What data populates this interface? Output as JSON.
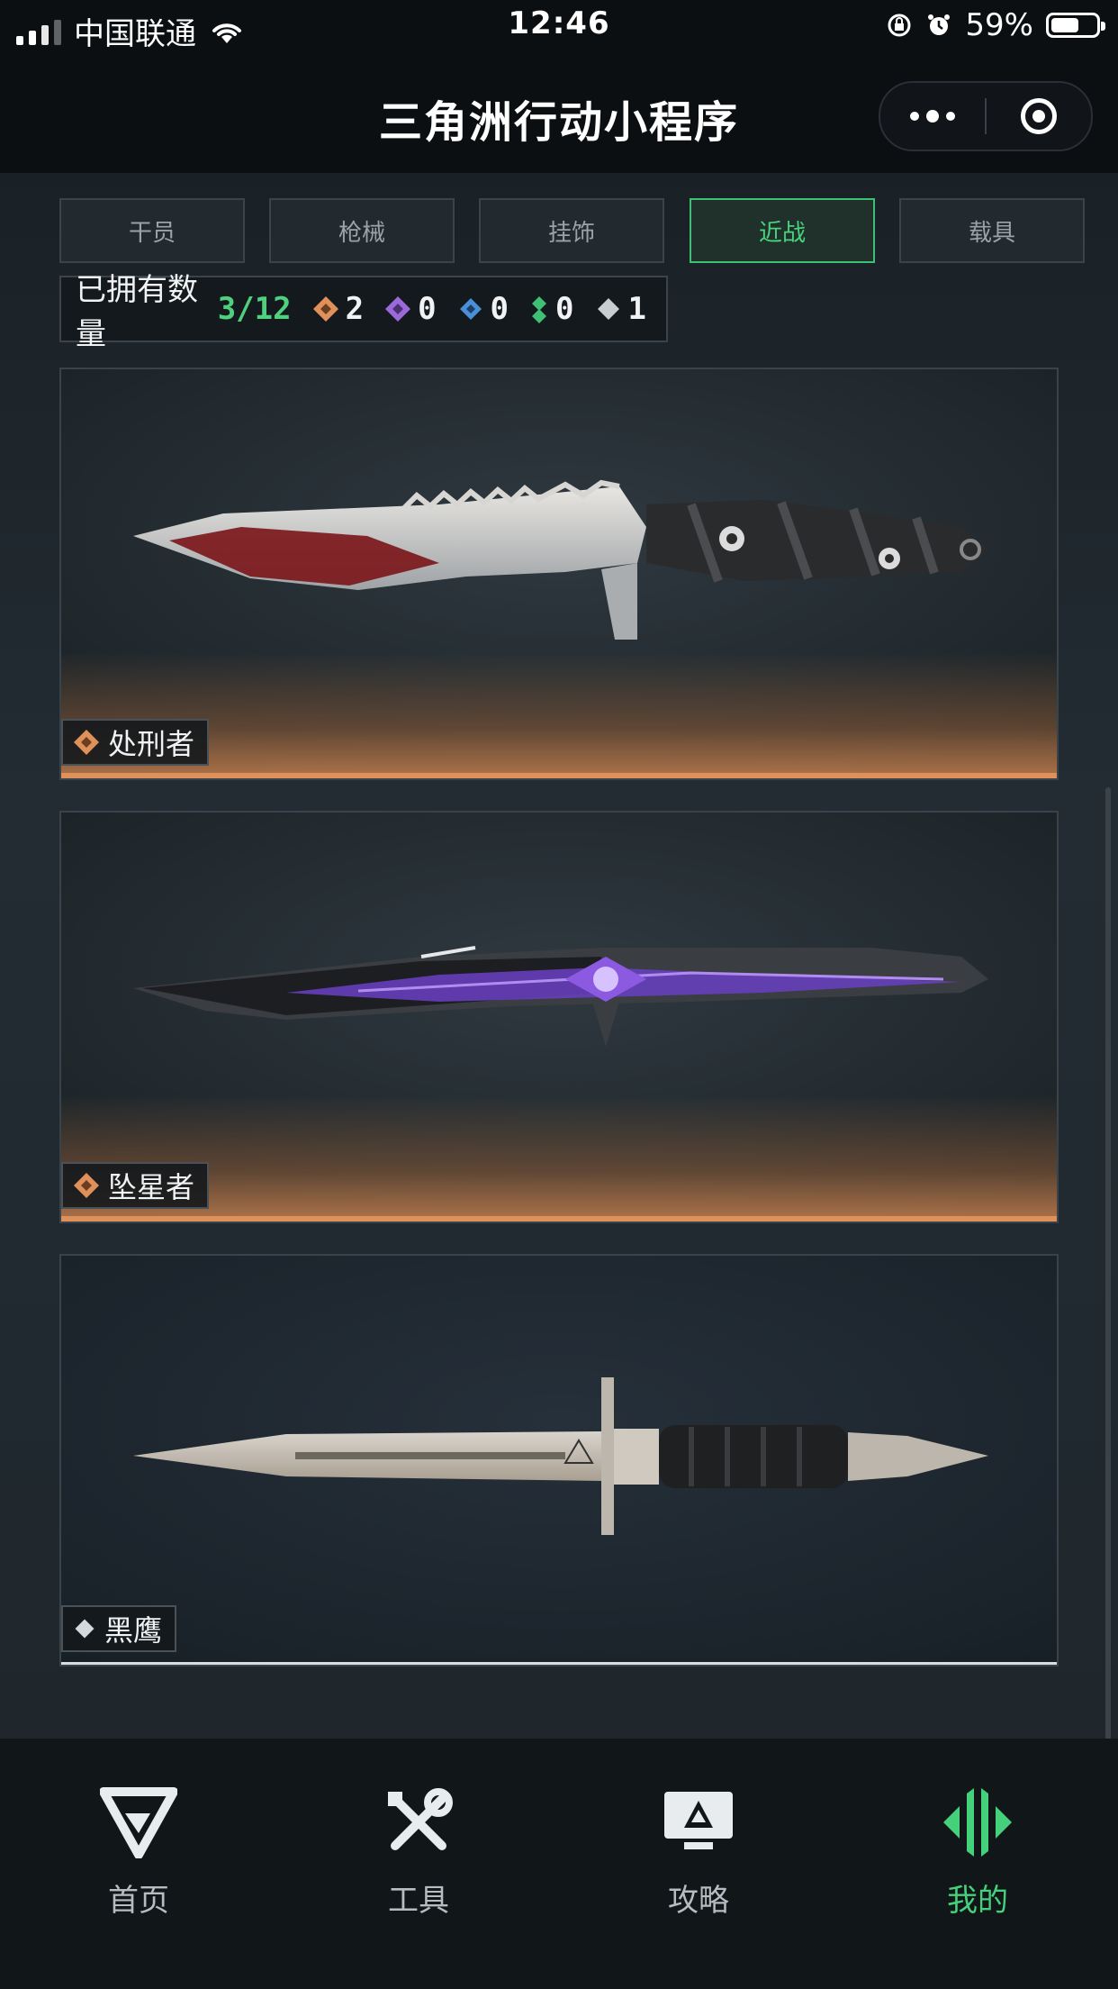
{
  "status_bar": {
    "carrier": "中国联通",
    "time": "12:46",
    "battery_pct": "59%",
    "battery_level": 0.59,
    "icons": [
      "signal-icon",
      "wifi-icon",
      "orientation-lock-icon",
      "alarm-icon",
      "battery-icon"
    ]
  },
  "header": {
    "title": "三角洲行动小程序",
    "menu_icon": "more-dots-icon",
    "close_icon": "target-circle-icon"
  },
  "tabs": [
    {
      "label": "干员",
      "active": false
    },
    {
      "label": "枪械",
      "active": false
    },
    {
      "label": "挂饰",
      "active": false
    },
    {
      "label": "近战",
      "active": true
    },
    {
      "label": "载具",
      "active": false
    }
  ],
  "owned": {
    "label": "已拥有数量",
    "count": "3/12",
    "stats": [
      {
        "value": "2",
        "color": "#e0905a",
        "icon": "diamond-orange-icon"
      },
      {
        "value": "0",
        "color": "#9b6ad8",
        "icon": "diamond-purple-icon"
      },
      {
        "value": "0",
        "color": "#4a8fd8",
        "icon": "diamond-blue-icon"
      },
      {
        "value": "0",
        "color": "#3fbf74",
        "icon": "diamond-green-icon"
      },
      {
        "value": "1",
        "color": "#c9cdd0",
        "icon": "diamond-gray-icon"
      }
    ]
  },
  "cards": [
    {
      "name": "处刑者",
      "rarity_color": "#e0905a"
    },
    {
      "name": "坠星者",
      "rarity_color": "#e0905a"
    },
    {
      "name": "黑鹰",
      "rarity_color": "#d9dde0"
    }
  ],
  "bottom_nav": [
    {
      "label": "首页",
      "icon": "home-g-logo-icon",
      "active": false
    },
    {
      "label": "工具",
      "icon": "tools-icon",
      "active": false
    },
    {
      "label": "攻略",
      "icon": "guide-monitor-icon",
      "active": false
    },
    {
      "label": "我的",
      "icon": "profile-emblem-icon",
      "active": true
    }
  ],
  "colors": {
    "accent": "#45d07c",
    "gold": "#e0905a"
  }
}
